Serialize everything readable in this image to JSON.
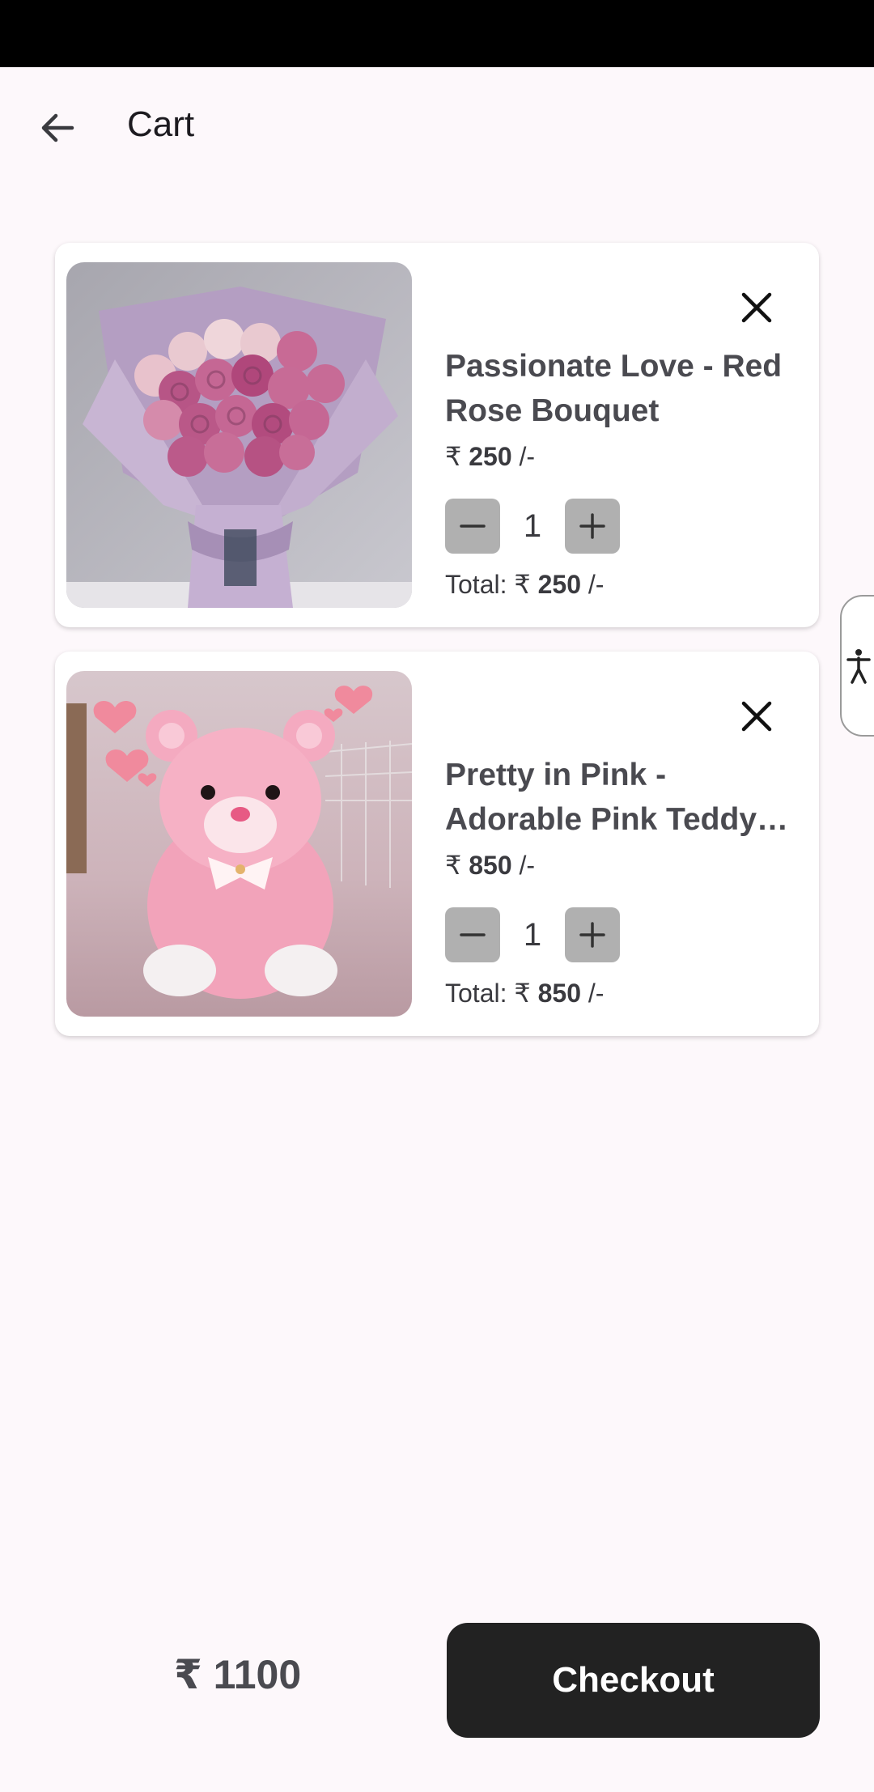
{
  "app_bar": {
    "title": "Cart",
    "back_icon": "arrow-back-icon"
  },
  "cart_items": [
    {
      "name": "Passionate Love - Red Rose Bouquet",
      "price_symbol": "₹",
      "price_value": "250",
      "price_suffix": "/-",
      "quantity": "1",
      "total_label": "Total: ₹",
      "total_value": "250",
      "total_suffix": "/-",
      "image": "rose-bouquet-image"
    },
    {
      "name": "Pretty in Pink - Adorable Pink Teddy…",
      "price_symbol": "₹",
      "price_value": "850",
      "price_suffix": "/-",
      "quantity": "1",
      "total_label": "Total: ₹",
      "total_value": "850",
      "total_suffix": "/-",
      "image": "pink-teddy-image"
    }
  ],
  "footer": {
    "grand_total": "₹ 1100",
    "checkout_label": "Checkout"
  },
  "colors": {
    "background": "#fdf8fb",
    "checkout_bg": "#222222",
    "qty_button_bg": "#b0b0b0"
  }
}
